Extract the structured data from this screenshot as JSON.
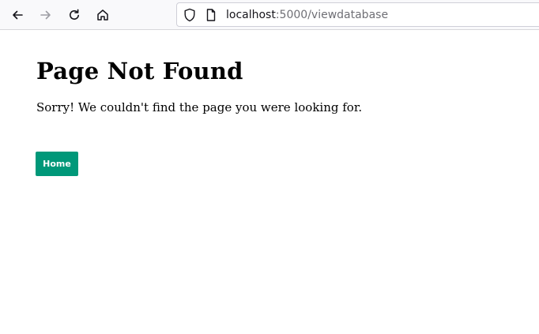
{
  "browser": {
    "url_host": "localhost",
    "url_rest": ":5000/viewdatabase",
    "icons": {
      "back": "arrow-left-icon",
      "forward": "arrow-right-icon",
      "reload": "reload-icon",
      "home": "home-icon",
      "security": "shield-icon",
      "page": "page-icon"
    }
  },
  "page": {
    "heading": "Page Not Found",
    "message": "Sorry! We couldn't find the page you were looking for.",
    "home_button_label": "Home",
    "accent_color": "#009879"
  }
}
